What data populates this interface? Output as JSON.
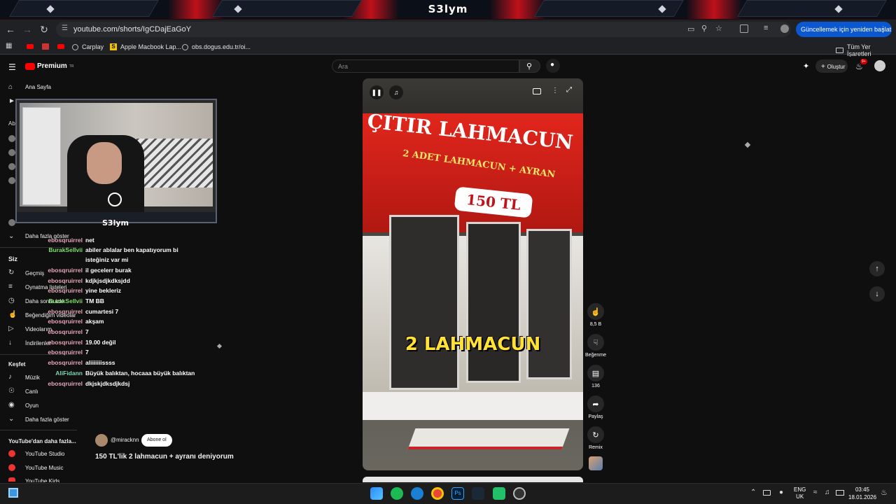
{
  "overlay": {
    "brand": "S3lym",
    "cam_brand": "S3lym"
  },
  "browser": {
    "url": "youtube.com/shorts/IgCDajEaGoY",
    "update_label": "Güncellemek için yeniden başlat",
    "bookmarks": [
      {
        "label": "Carplay"
      },
      {
        "label": "Apple Macbook Lap..."
      },
      {
        "label": "obs.dogus.edu.tr/oi..."
      }
    ],
    "all_bookmarks": "Tüm Yer İşaretleri"
  },
  "youtube": {
    "logo": "Premium",
    "logo_sup": "TR",
    "search_placeholder": "Ara",
    "create_label": "Oluştur",
    "notif_count": "9+",
    "sidebar": {
      "home": "Ana Sayfa",
      "show_more_1": "Daha fazla göster",
      "you": "Siz",
      "history": "Geçmiş",
      "playlists": "Oynatma listeleri",
      "watch_later": "Daha sonra izle",
      "liked": "Beğendiğim videolar",
      "your_videos": "Videolarım",
      "downloads": "İndirilenler",
      "explore": "Keşfet",
      "music": "Müzik",
      "live": "Canlı",
      "gaming": "Oyun",
      "show_more_2": "Daha fazla göster",
      "more_from": "YouTube'dan daha fazla...",
      "studio": "YouTube Studio",
      "yt_music": "YouTube Music",
      "yt_kids": "YouTube Kids"
    },
    "short": {
      "sign_top": "ÇITIR LAHMACUN",
      "sign_mid": "2 ADET LAHMACUN + AYRAN",
      "sign_price": "150 TL",
      "caption": "2 LAHMACUN",
      "channel": "@miracknn",
      "subscribe": "Abone ol",
      "title": "150 TL'lik 2 lahmacun + ayranı deniyorum"
    },
    "actions": {
      "likes": "8,5 B",
      "dislike": "Beğenme",
      "comments": "136",
      "share": "Paylaş",
      "remix": "Remix"
    }
  },
  "chat": [
    {
      "user": "ebosqruirrel",
      "msg": "net",
      "color": "pink"
    },
    {
      "user": "BurakSellvii",
      "msg": "abiler ablalar ben kapatıyorum bi",
      "color": "green"
    },
    {
      "user": "",
      "msg": "isteğiniz var mi",
      "color": "pink"
    },
    {
      "user": "ebosqruirrel",
      "msg": "il gecelerr burak",
      "color": "pink"
    },
    {
      "user": "ebosqruirrel",
      "msg": "kdjkjsdjkdksjdd",
      "color": "pink"
    },
    {
      "user": "ebosqruirrel",
      "msg": "yine bekleriz",
      "color": "pink"
    },
    {
      "user": "BurakSellvii",
      "msg": "TM BB",
      "color": "green"
    },
    {
      "user": "ebosqruirrel",
      "msg": "cumartesi 7",
      "color": "pink"
    },
    {
      "user": "ebosqruirrel",
      "msg": "akşam",
      "color": "pink"
    },
    {
      "user": "ebosqruirrel",
      "msg": "7",
      "color": "pink"
    },
    {
      "user": "ebosqruirrel",
      "msg": "19.00 değil",
      "color": "pink"
    },
    {
      "user": "ebosqruirrel",
      "msg": "7",
      "color": "pink"
    },
    {
      "user": "ebosqruirrel",
      "msg": "aliiiiiiissss",
      "color": "pink"
    },
    {
      "user": "AliFidann",
      "msg": "Büyük balıktan, hocaaa büyük balıktan",
      "color": "teal"
    },
    {
      "user": "ebosqruirrel",
      "msg": "dkjskjdksdjkdsj",
      "color": "pink"
    }
  ],
  "taskbar": {
    "lang1": "ENG",
    "lang2": "UK",
    "time": "03:45",
    "date": "18.01.2026"
  }
}
